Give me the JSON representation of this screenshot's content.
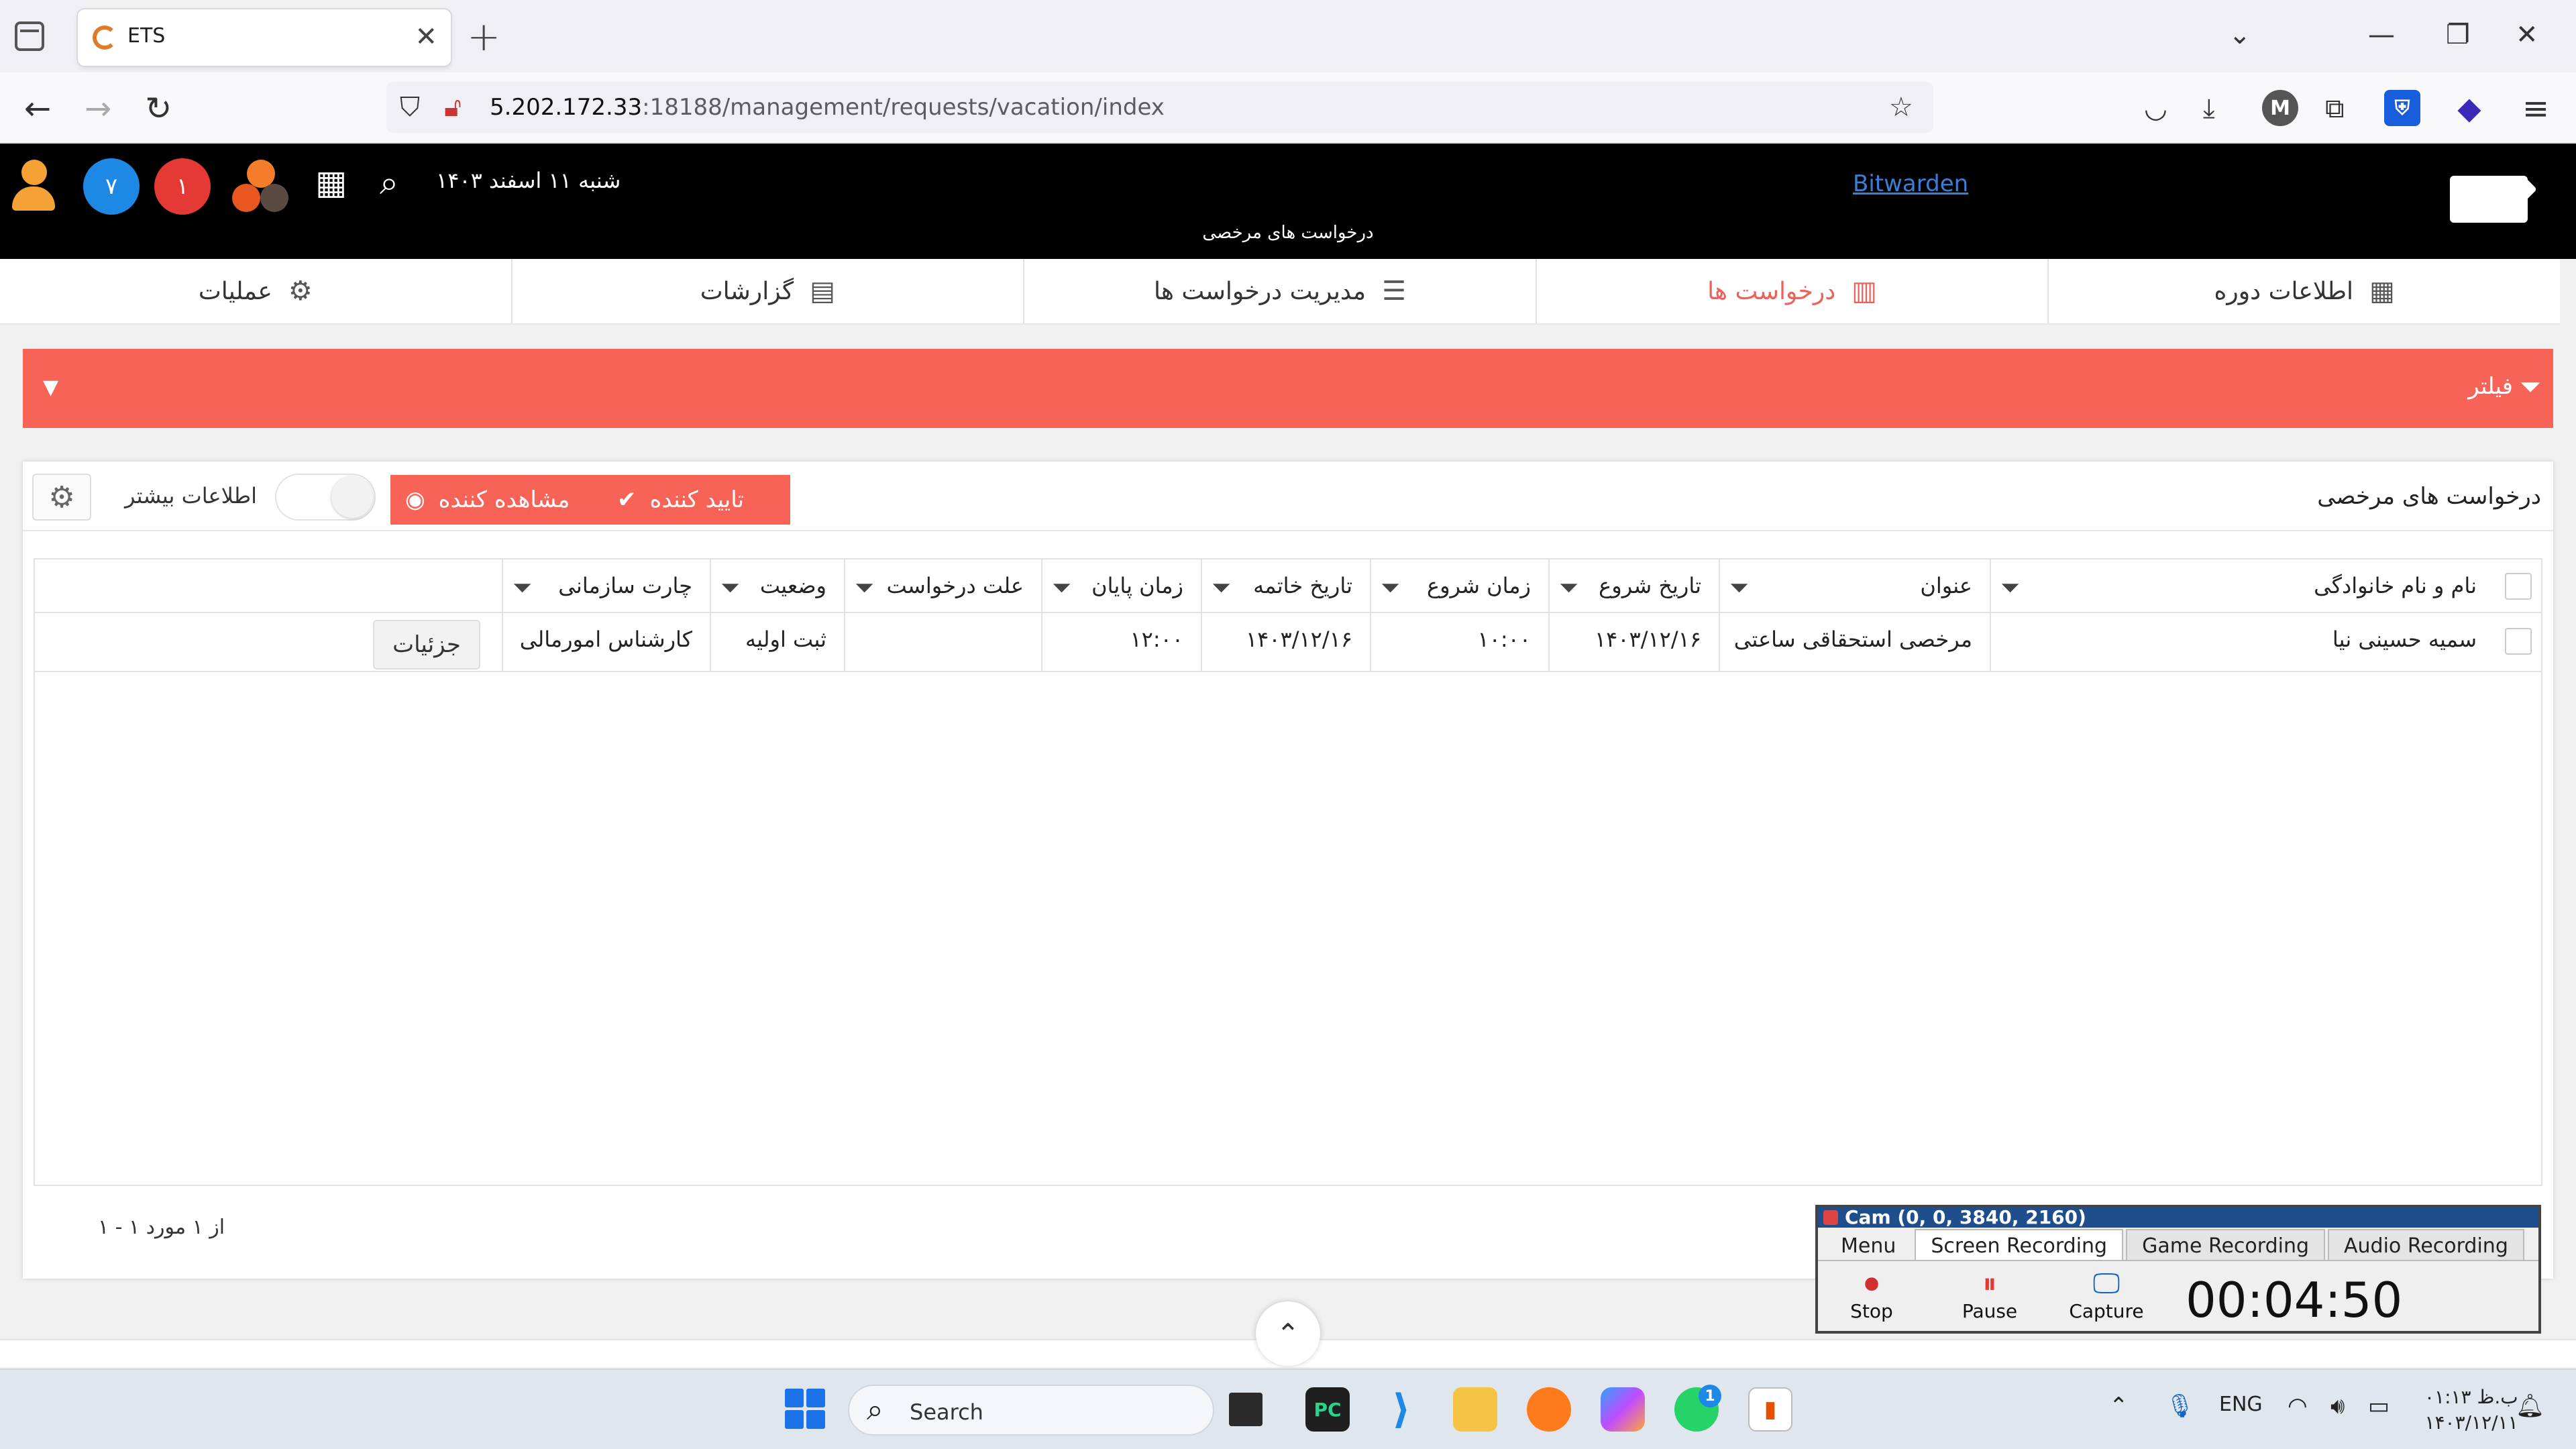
{
  "browser": {
    "tab_title": "ETS",
    "url_host": "5.202.172.33",
    "url_rest": ":18188/management/requests/vacation/index"
  },
  "header": {
    "badge_blue": "۷",
    "badge_red": "۱",
    "date": "شنبه ۱۱ اسفند ۱۴۰۳",
    "page_title": "درخواست های مرخصی",
    "bitwarden_link": "Bitwarden"
  },
  "nav": {
    "items": [
      {
        "label": "عملیات",
        "icon": "user-gear-icon"
      },
      {
        "label": "گزارشات",
        "icon": "report-icon"
      },
      {
        "label": "مدیریت درخواست ها",
        "icon": "list-check-icon"
      },
      {
        "label": "درخواست ها",
        "icon": "requests-icon"
      },
      {
        "label": "اطلاعات دوره",
        "icon": "calendar-icon"
      }
    ],
    "active_index": 3
  },
  "filter": {
    "label": "فیلتر"
  },
  "panel": {
    "title": "درخواست های مرخصی",
    "more_info_label": "اطلاعات بیشتر",
    "approver_button": "تایید کننده",
    "viewer_button": "مشاهده کننده"
  },
  "grid": {
    "columns": [
      "نام و نام خانوادگی",
      "عنوان",
      "تاریخ شروع",
      "زمان شروع",
      "تاریخ خاتمه",
      "زمان پایان",
      "علت درخواست",
      "وضعیت",
      "چارت سازمانی"
    ],
    "rows": [
      {
        "name": "سمیه حسینی نیا",
        "title": "مرخصی استحقاقی ساعتی",
        "start_date": "۱۴۰۳/۱۲/۱۶",
        "start_time": "۱۰:۰۰",
        "end_date": "۱۴۰۳/۱۲/۱۶",
        "end_time": "۱۲:۰۰",
        "reason": "",
        "status": "ثبت اولیه",
        "org_chart": "کارشناس امورمالی",
        "details_button": "جزئیات"
      }
    ],
    "pager_info": "۱ - ۱ از ۱ مورد"
  },
  "recorder": {
    "title": "Cam (0, 0, 3840, 2160)",
    "tabs": [
      "Menu",
      "Screen Recording",
      "Game Recording",
      "Audio Recording"
    ],
    "active_tab": "Screen Recording",
    "buttons": [
      "Stop",
      "Pause",
      "Capture"
    ],
    "timer": "00:04:50"
  },
  "taskbar": {
    "search_label": "Search",
    "language": "ENG",
    "time": "۰۱:۱۳ ب.ظ",
    "date": "۱۴۰۳/۱۲/۱۱",
    "whatsapp_badge": "1"
  },
  "colors": {
    "accent": "#f86357",
    "header_bg": "#000000",
    "badge_blue": "#1e88e5",
    "badge_red": "#e53935"
  }
}
